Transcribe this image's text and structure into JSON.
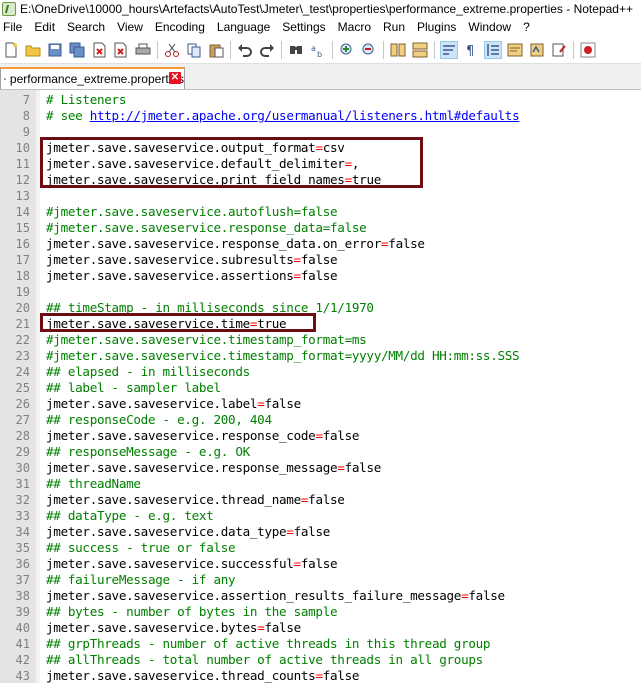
{
  "window": {
    "title": "E:\\OneDrive\\10000_hours\\Artefacts\\AutoTest\\Jmeter\\_test\\properties\\performance_extreme.properties - Notepad++"
  },
  "menu": [
    "File",
    "Edit",
    "Search",
    "View",
    "Encoding",
    "Language",
    "Settings",
    "Macro",
    "Run",
    "Plugins",
    "Window",
    "?"
  ],
  "toolbar": {
    "icons": [
      "new-file-icon",
      "open-file-icon",
      "save-icon",
      "save-all-icon",
      "close-icon",
      "close-all-icon",
      "print-icon",
      "cut-icon",
      "copy-icon",
      "paste-icon",
      "undo-icon",
      "redo-icon",
      "find-icon",
      "replace-icon",
      "zoom-in-icon",
      "zoom-out-icon",
      "sync-vertical-icon",
      "sync-horizontal-icon",
      "word-wrap-icon",
      "show-all-chars-icon",
      "indent-guide-icon",
      "doc-map-icon",
      "function-list-icon",
      "folder-workspace-icon",
      "record-macro-icon"
    ]
  },
  "tab": {
    "label": "performance_extreme.properties",
    "close": "✕"
  },
  "colors": {
    "comment": "#008000",
    "operator": "#ff0000",
    "link": "#0000ff",
    "highlight_box": "#6b0d12"
  },
  "lines": [
    {
      "n": "7",
      "parts": [
        [
          "c",
          "# Listeners"
        ]
      ]
    },
    {
      "n": "8",
      "parts": [
        [
          "c",
          "# see "
        ],
        [
          "l",
          "http://jmeter.apache.org/usermanual/listeners.html#defaults"
        ]
      ]
    },
    {
      "n": "9",
      "parts": []
    },
    {
      "n": "10",
      "parts": [
        [
          "k",
          "jmeter.save.saveservice.output_format"
        ],
        [
          "e",
          "="
        ],
        [
          "v",
          "csv"
        ]
      ]
    },
    {
      "n": "11",
      "parts": [
        [
          "k",
          "jmeter.save.saveservice.default_delimiter"
        ],
        [
          "e",
          "="
        ],
        [
          "v",
          ","
        ]
      ]
    },
    {
      "n": "12",
      "parts": [
        [
          "k",
          "jmeter.save.saveservice.print_field_names"
        ],
        [
          "e",
          "="
        ],
        [
          "v",
          "true"
        ]
      ]
    },
    {
      "n": "13",
      "parts": []
    },
    {
      "n": "14",
      "parts": [
        [
          "c",
          "#jmeter.save.saveservice.autoflush=false"
        ]
      ]
    },
    {
      "n": "15",
      "parts": [
        [
          "c",
          "#jmeter.save.saveservice.response_data=false"
        ]
      ]
    },
    {
      "n": "16",
      "parts": [
        [
          "k",
          "jmeter.save.saveservice.response_data.on_error"
        ],
        [
          "e",
          "="
        ],
        [
          "v",
          "false"
        ]
      ]
    },
    {
      "n": "17",
      "parts": [
        [
          "k",
          "jmeter.save.saveservice.subresults"
        ],
        [
          "e",
          "="
        ],
        [
          "v",
          "false"
        ]
      ]
    },
    {
      "n": "18",
      "parts": [
        [
          "k",
          "jmeter.save.saveservice.assertions"
        ],
        [
          "e",
          "="
        ],
        [
          "v",
          "false"
        ]
      ]
    },
    {
      "n": "19",
      "parts": []
    },
    {
      "n": "20",
      "parts": [
        [
          "c",
          "## timeStamp - in milliseconds since 1/1/1970"
        ]
      ]
    },
    {
      "n": "21",
      "parts": [
        [
          "k",
          "jmeter.save.saveservice.time"
        ],
        [
          "e",
          "="
        ],
        [
          "v",
          "true"
        ]
      ]
    },
    {
      "n": "22",
      "parts": [
        [
          "c",
          "#jmeter.save.saveservice.timestamp_format=ms"
        ]
      ]
    },
    {
      "n": "23",
      "parts": [
        [
          "c",
          "#jmeter.save.saveservice.timestamp_format=yyyy/MM/dd HH:mm:ss.SSS"
        ]
      ]
    },
    {
      "n": "24",
      "parts": [
        [
          "c",
          "## elapsed - in milliseconds"
        ]
      ]
    },
    {
      "n": "25",
      "parts": [
        [
          "c",
          "## label - sampler label"
        ]
      ]
    },
    {
      "n": "26",
      "parts": [
        [
          "k",
          "jmeter.save.saveservice.label"
        ],
        [
          "e",
          "="
        ],
        [
          "v",
          "false"
        ]
      ]
    },
    {
      "n": "27",
      "parts": [
        [
          "c",
          "## responseCode - e.g. 200, 404"
        ]
      ]
    },
    {
      "n": "28",
      "parts": [
        [
          "k",
          "jmeter.save.saveservice.response_code"
        ],
        [
          "e",
          "="
        ],
        [
          "v",
          "false"
        ]
      ]
    },
    {
      "n": "29",
      "parts": [
        [
          "c",
          "## responseMessage - e.g. OK"
        ]
      ]
    },
    {
      "n": "30",
      "parts": [
        [
          "k",
          "jmeter.save.saveservice.response_message"
        ],
        [
          "e",
          "="
        ],
        [
          "v",
          "false"
        ]
      ]
    },
    {
      "n": "31",
      "parts": [
        [
          "c",
          "## threadName"
        ]
      ]
    },
    {
      "n": "32",
      "parts": [
        [
          "k",
          "jmeter.save.saveservice.thread_name"
        ],
        [
          "e",
          "="
        ],
        [
          "v",
          "false"
        ]
      ]
    },
    {
      "n": "33",
      "parts": [
        [
          "c",
          "## dataType - e.g. text"
        ]
      ]
    },
    {
      "n": "34",
      "parts": [
        [
          "k",
          "jmeter.save.saveservice.data_type"
        ],
        [
          "e",
          "="
        ],
        [
          "v",
          "false"
        ]
      ]
    },
    {
      "n": "35",
      "parts": [
        [
          "c",
          "## success - true or false"
        ]
      ]
    },
    {
      "n": "36",
      "parts": [
        [
          "k",
          "jmeter.save.saveservice.successful"
        ],
        [
          "e",
          "="
        ],
        [
          "v",
          "false"
        ]
      ]
    },
    {
      "n": "37",
      "parts": [
        [
          "c",
          "## failureMessage - if any"
        ]
      ]
    },
    {
      "n": "38",
      "parts": [
        [
          "k",
          "jmeter.save.saveservice.assertion_results_failure_message"
        ],
        [
          "e",
          "="
        ],
        [
          "v",
          "false"
        ]
      ]
    },
    {
      "n": "39",
      "parts": [
        [
          "c",
          "## bytes - number of bytes in the sample"
        ]
      ]
    },
    {
      "n": "40",
      "parts": [
        [
          "k",
          "jmeter.save.saveservice.bytes"
        ],
        [
          "e",
          "="
        ],
        [
          "v",
          "false"
        ]
      ]
    },
    {
      "n": "41",
      "parts": [
        [
          "c",
          "## grpThreads - number of active threads in this thread group"
        ]
      ]
    },
    {
      "n": "42",
      "parts": [
        [
          "c",
          "## allThreads - total number of active threads in all groups"
        ]
      ]
    },
    {
      "n": "43",
      "parts": [
        [
          "k",
          "jmeter.save.saveservice.thread_counts"
        ],
        [
          "e",
          "="
        ],
        [
          "v",
          "false"
        ]
      ]
    }
  ]
}
